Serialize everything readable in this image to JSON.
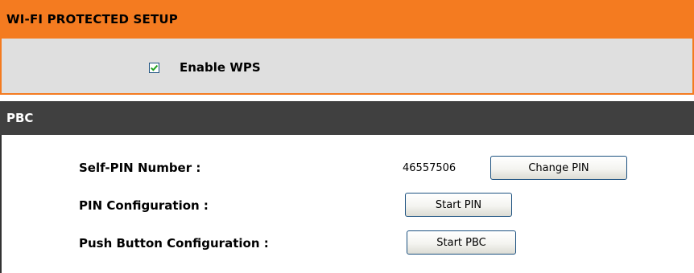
{
  "wps": {
    "title": "WI-FI PROTECTED SETUP",
    "enable_label": "Enable WPS",
    "enable_checked": true
  },
  "pbc": {
    "title": "PBC",
    "self_pin_label": "Self-PIN Number :",
    "self_pin_value": "46557506",
    "change_pin_label": "Change PIN",
    "pin_config_label": "PIN Configuration :",
    "start_pin_label": "Start PIN",
    "push_button_label": "Push Button Configuration :",
    "start_pbc_label": "Start PBC"
  },
  "colors": {
    "wps_header": "#f47b20",
    "wps_body": "#dfdfdf",
    "pbc_header": "#404040",
    "button_border": "#1c5180",
    "checkmark": "#21a121"
  }
}
